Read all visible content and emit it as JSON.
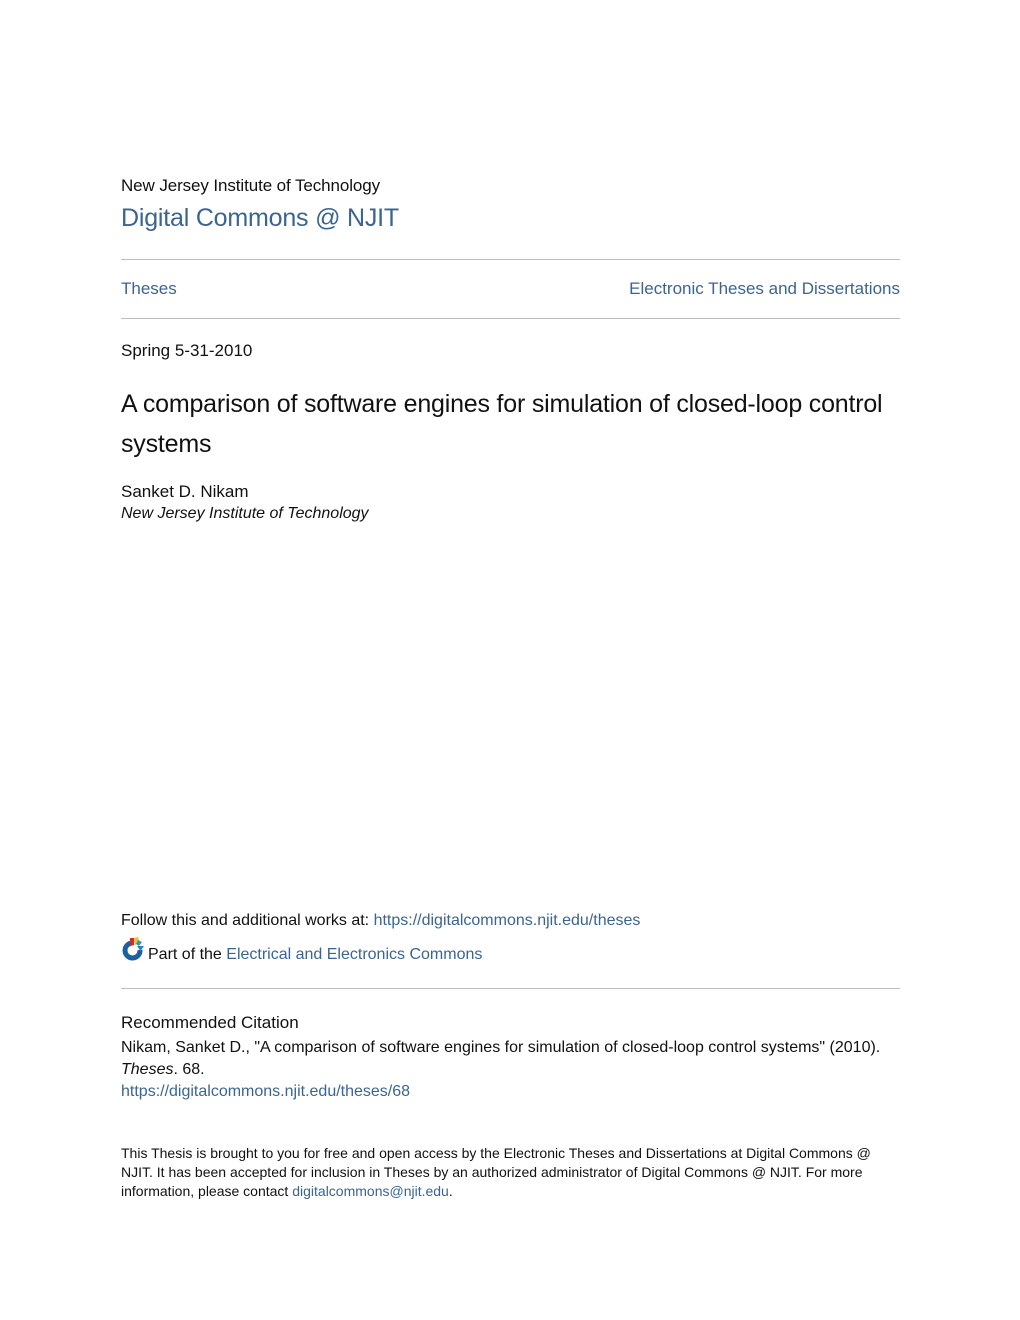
{
  "header": {
    "institution": "New Jersey Institute of Technology",
    "repository_title": "Digital Commons @ NJIT"
  },
  "breadcrumb": {
    "left": "Theses",
    "right": "Electronic Theses and Dissertations"
  },
  "document": {
    "date": "Spring 5-31-2010",
    "title": "A comparison of software engines for simulation of closed-loop control systems",
    "author": "Sanket D. Nikam",
    "affiliation": "New Jersey Institute of Technology"
  },
  "links": {
    "follow_label": "Follow this and additional works at: ",
    "follow_url": "https://digitalcommons.njit.edu/theses",
    "part_of_label": "Part of the ",
    "part_of_link": "Electrical and Electronics Commons",
    "network_icon": "bepress-network-icon"
  },
  "citation": {
    "heading": "Recommended Citation",
    "text_pre": "Nikam, Sanket D., \"A comparison of software engines for simulation of closed-loop control systems\" (2010). ",
    "series": "Theses",
    "text_post": ". 68.",
    "url": "https://digitalcommons.njit.edu/theses/68"
  },
  "footer": {
    "text": "This Thesis is brought to you for free and open access by the Electronic Theses and Dissertations at Digital Commons @ NJIT. It has been accepted for inclusion in Theses by an authorized administrator of Digital Commons @ NJIT. For more information, please contact ",
    "email": "digitalcommons@njit.edu",
    "end": "."
  },
  "colors": {
    "link": "#3a6593",
    "text": "#111111",
    "rule": "#bdbdbd"
  }
}
